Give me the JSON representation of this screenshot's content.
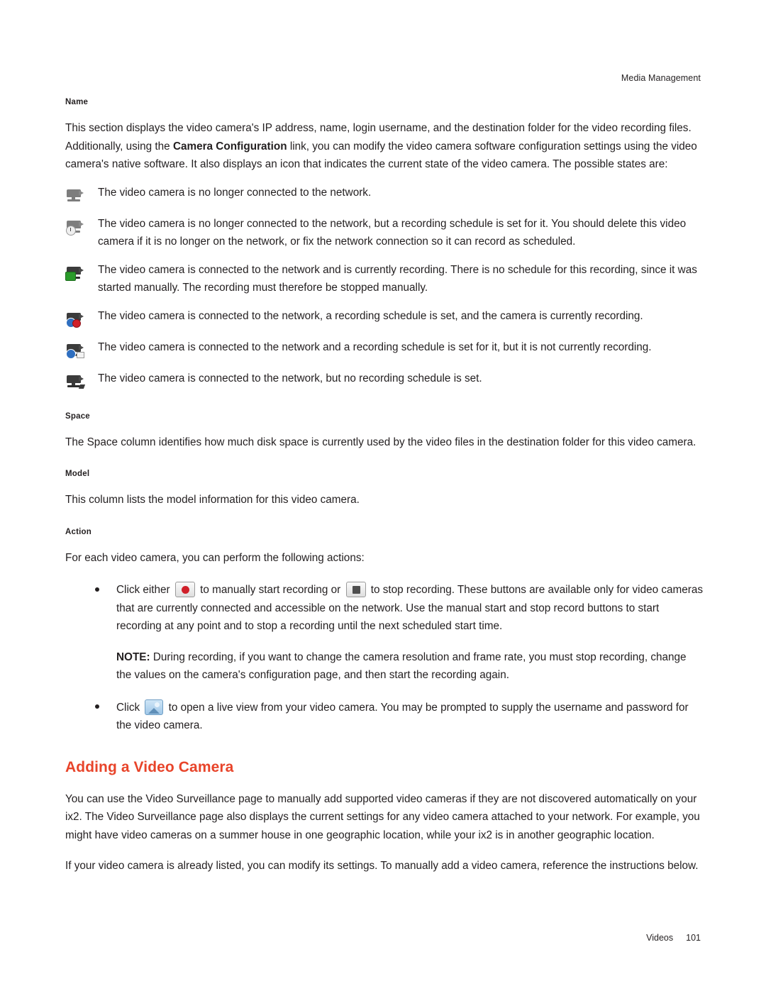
{
  "header": {
    "right_text": "Media Management"
  },
  "sections": {
    "name": {
      "heading": "Name",
      "intro_part1": "This section displays the video camera's IP address, name, login username, and the destination folder for the video recording files. Additionally, using the ",
      "intro_bold": "Camera Configuration",
      "intro_part2": " link, you can modify the video camera software configuration settings using the video camera's native software. It also displays an icon that indicates the current state of the video camera. The possible states are:",
      "states": [
        {
          "icon": "camera-disconnected-icon",
          "text": "The video camera is no longer connected to the network."
        },
        {
          "icon": "camera-disconnected-scheduled-icon",
          "text": "The video camera is no longer connected to the network, but a recording schedule is set for it. You should delete this video camera if it is no longer on the network, or fix the network connection so it can record as scheduled."
        },
        {
          "icon": "camera-recording-manual-icon",
          "text": "The video camera is connected to the network and is currently recording. There is no schedule for this recording, since it was started manually. The recording must therefore be stopped manually."
        },
        {
          "icon": "camera-recording-scheduled-icon",
          "text": "The video camera is connected to the network, a recording schedule is set, and the camera is currently recording."
        },
        {
          "icon": "camera-scheduled-not-recording-icon",
          "text": "The video camera is connected to the network and a recording schedule is set for it, but it is not currently recording."
        },
        {
          "icon": "camera-connected-no-schedule-icon",
          "text": "The video camera is connected to the network, but no recording schedule is set."
        }
      ]
    },
    "space": {
      "heading": "Space",
      "text": "The Space column identifies how much disk space is currently used by the video files in the destination folder for this video camera."
    },
    "model": {
      "heading": "Model",
      "text": "This column lists the model information for this video camera."
    },
    "action": {
      "heading": "Action",
      "intro": "For each video camera, you can perform the following actions:",
      "bullet1_part1": "Click either ",
      "bullet1_part2": " to manually start recording or ",
      "bullet1_part3": " to stop recording. These buttons are available only for video cameras that are currently connected and accessible on the network. Use the manual start and stop record buttons to start recording at any point and to stop a recording until the next scheduled start time.",
      "note_label": "NOTE:",
      "note_text": " During recording, if you want to change the camera resolution and frame rate, you must stop recording, change the values on the camera's configuration page, and then start the recording again.",
      "bullet2_part1": "Click ",
      "bullet2_part2": " to open a live view from your video camera. You may be prompted to supply the username and password for the video camera."
    }
  },
  "adding_camera": {
    "title": "Adding a Video Camera",
    "paragraph1": "You can use the Video Surveillance page to manually add supported video cameras if they are not discovered automatically on your ix2. The Video Surveillance page also displays the current settings for any video camera attached to your network. For example, you might have video cameras on a summer house in one geographic location, while your ix2 is in another geographic location.",
    "paragraph2": "If your video camera is already listed, you can modify its settings. To manually add a video camera, reference the instructions below."
  },
  "footer": {
    "label": "Videos",
    "page_number": "101"
  },
  "colors": {
    "section_title": "#e8442a",
    "text": "#231f20",
    "record_red": "#d0202a",
    "recording_green": "#2a9b2a",
    "badge_blue": "#2f6fc0"
  }
}
